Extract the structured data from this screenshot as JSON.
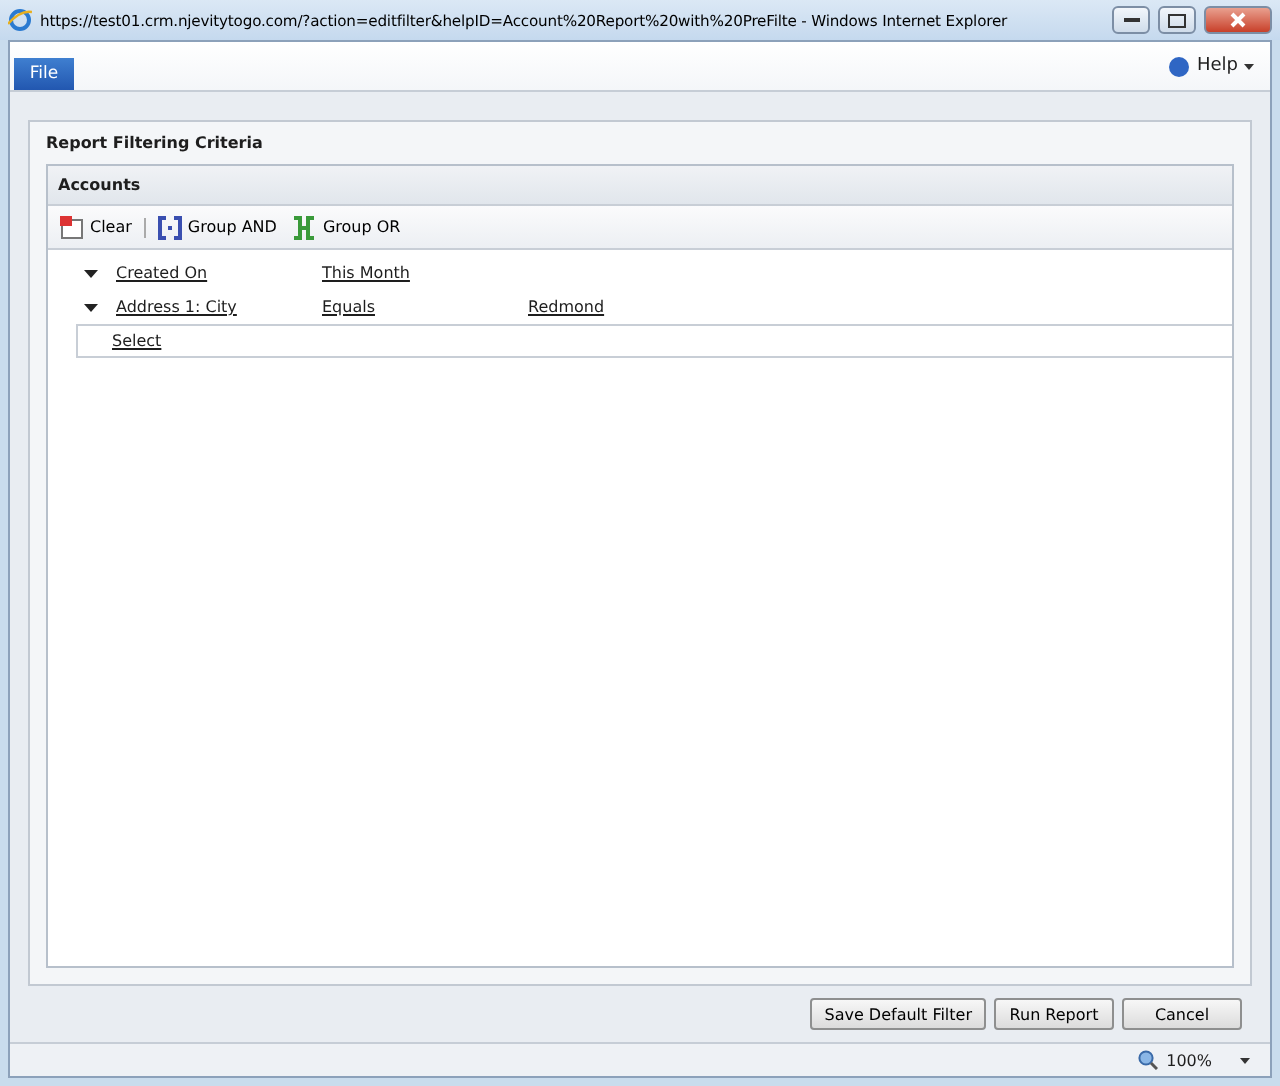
{
  "window": {
    "title": "https://test01.crm.njevitytogo.com/?action=editfilter&helpID=Account%20Report%20with%20PreFilte - Windows Internet Explorer"
  },
  "menu": {
    "file_tab": "File",
    "help": "Help"
  },
  "section_title": "Report Filtering Criteria",
  "entity_title": "Accounts",
  "toolbar": [
    {
      "kind": "clear",
      "label": "Clear"
    },
    {
      "kind": "and",
      "label": "Group AND"
    },
    {
      "kind": "or",
      "label": "Group OR"
    }
  ],
  "conditions": [
    {
      "field": "Created On",
      "operator": "This Month"
    },
    {
      "field": "Address 1: City",
      "operator": "Equals",
      "value": "Redmond"
    }
  ],
  "select_link": "Select",
  "buttons": [
    "Save Default Filter",
    "Run Report",
    "Cancel"
  ],
  "status_bar": {
    "zoom": "100%"
  }
}
